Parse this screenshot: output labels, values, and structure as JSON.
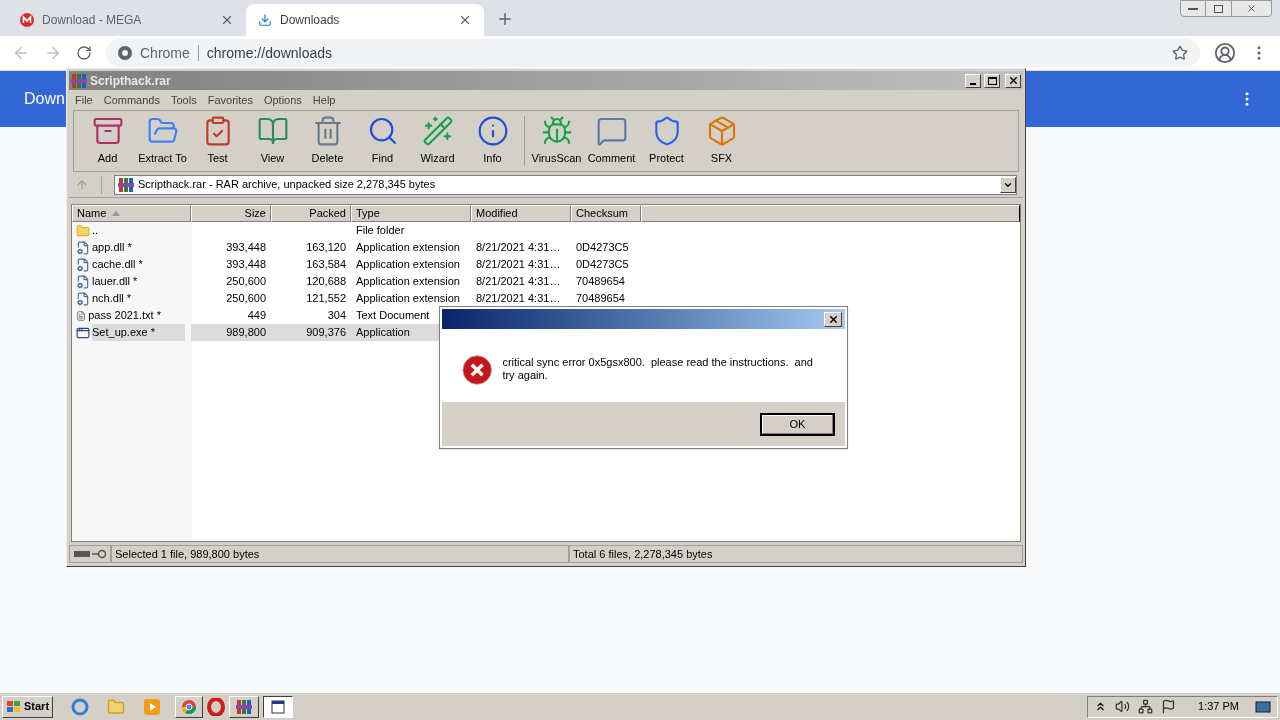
{
  "browser": {
    "tabs": [
      {
        "title": "Download - MEGA",
        "selected": false
      },
      {
        "title": "Downloads",
        "selected": true
      }
    ],
    "address": {
      "site_label": "Chrome",
      "url": "chrome://downloads"
    },
    "page": {
      "heading": "Down"
    }
  },
  "winrar": {
    "title": "Scripthack.rar",
    "active": false,
    "menu": [
      "File",
      "Commands",
      "Tools",
      "Favorites",
      "Options",
      "Help"
    ],
    "toolbar_groups": [
      [
        "Add",
        "Extract To",
        "Test",
        "View",
        "Delete",
        "Find",
        "Wizard",
        "Info"
      ],
      [
        "VirusScan",
        "Comment",
        "Protect",
        "SFX"
      ]
    ],
    "path": "Scripthack.rar - RAR archive, unpacked size 2,278,345 bytes",
    "columns": [
      {
        "label": "Name",
        "sorted": true
      },
      {
        "label": "Size",
        "sorted": false
      },
      {
        "label": "Packed",
        "sorted": false
      },
      {
        "label": "Type",
        "sorted": false
      },
      {
        "label": "Modified",
        "sorted": false
      },
      {
        "label": "Checksum",
        "sorted": false
      }
    ],
    "rows": [
      {
        "kind": "folder",
        "name": "..",
        "type": "File folder",
        "selected": false
      },
      {
        "kind": "dll",
        "name": "app.dll *",
        "size": "393,448",
        "packed": "163,120",
        "type": "Application extension",
        "modified": "8/21/2021 4:31…",
        "checksum": "0D4273C5",
        "selected": false
      },
      {
        "kind": "dll",
        "name": "cache.dll *",
        "size": "393,448",
        "packed": "163,584",
        "type": "Application extension",
        "modified": "8/21/2021 4:31…",
        "checksum": "0D4273C5",
        "selected": false
      },
      {
        "kind": "dll",
        "name": "lauer.dll *",
        "size": "250,600",
        "packed": "120,688",
        "type": "Application extension",
        "modified": "8/21/2021 4:31…",
        "checksum": "70489654",
        "selected": false
      },
      {
        "kind": "dll",
        "name": "nch.dll *",
        "size": "250,600",
        "packed": "121,552",
        "type": "Application extension",
        "modified": "8/21/2021 4:31…",
        "checksum": "70489654",
        "selected": false
      },
      {
        "kind": "txt",
        "name": "pass 2021.txt *",
        "size": "449",
        "packed": "304",
        "type": "Text Document",
        "selected": false
      },
      {
        "kind": "exe",
        "name": "Set_up.exe *",
        "size": "989,800",
        "packed": "909,376",
        "type": "Application",
        "selected": true
      }
    ],
    "status": {
      "left": "Selected 1 file, 989,800 bytes",
      "right": "Total 6 files, 2,278,345 bytes"
    }
  },
  "dialog": {
    "message": "critical sync error 0x5gsx800.  please read the instructions.  and try again.",
    "button": "OK"
  },
  "taskbar": {
    "start": "Start",
    "tasks": [
      {
        "kind": "winrar",
        "selected": false
      },
      {
        "kind": "dialog",
        "selected": true
      }
    ],
    "time": "1:37 PM"
  }
}
